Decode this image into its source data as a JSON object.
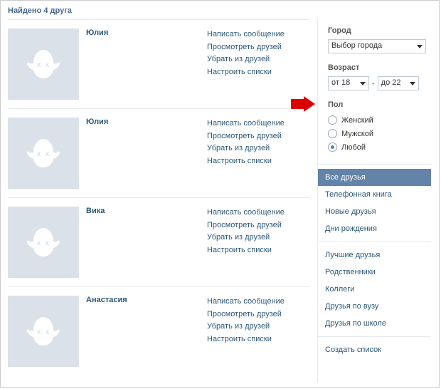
{
  "header": {
    "title": "Найдено 4 друга"
  },
  "actions": {
    "write": "Написать сообщение",
    "view": "Просмотреть друзей",
    "remove": "Убрать из друзей",
    "lists": "Настроить списки"
  },
  "friends": [
    {
      "name": "Юлия"
    },
    {
      "name": "Юлия"
    },
    {
      "name": "Вика"
    },
    {
      "name": "Анастасия"
    }
  ],
  "sidebar": {
    "city": {
      "label": "Город",
      "value": "Выбор города"
    },
    "age": {
      "label": "Возраст",
      "from": "от 18",
      "to": "до 22",
      "sep": "-"
    },
    "gender": {
      "label": "Пол",
      "options": [
        {
          "label": "Женский",
          "checked": false
        },
        {
          "label": "Мужской",
          "checked": false
        },
        {
          "label": "Любой",
          "checked": true
        }
      ]
    },
    "filters1": [
      {
        "label": "Все друзья",
        "active": true
      },
      {
        "label": "Телефонная книга"
      },
      {
        "label": "Новые друзья"
      },
      {
        "label": "Дни рождения"
      }
    ],
    "filters2": [
      {
        "label": "Лучшие друзья"
      },
      {
        "label": "Родственники"
      },
      {
        "label": "Коллеги"
      },
      {
        "label": "Друзья по вузу"
      },
      {
        "label": "Друзья по школе"
      }
    ],
    "create": "Создать список"
  }
}
